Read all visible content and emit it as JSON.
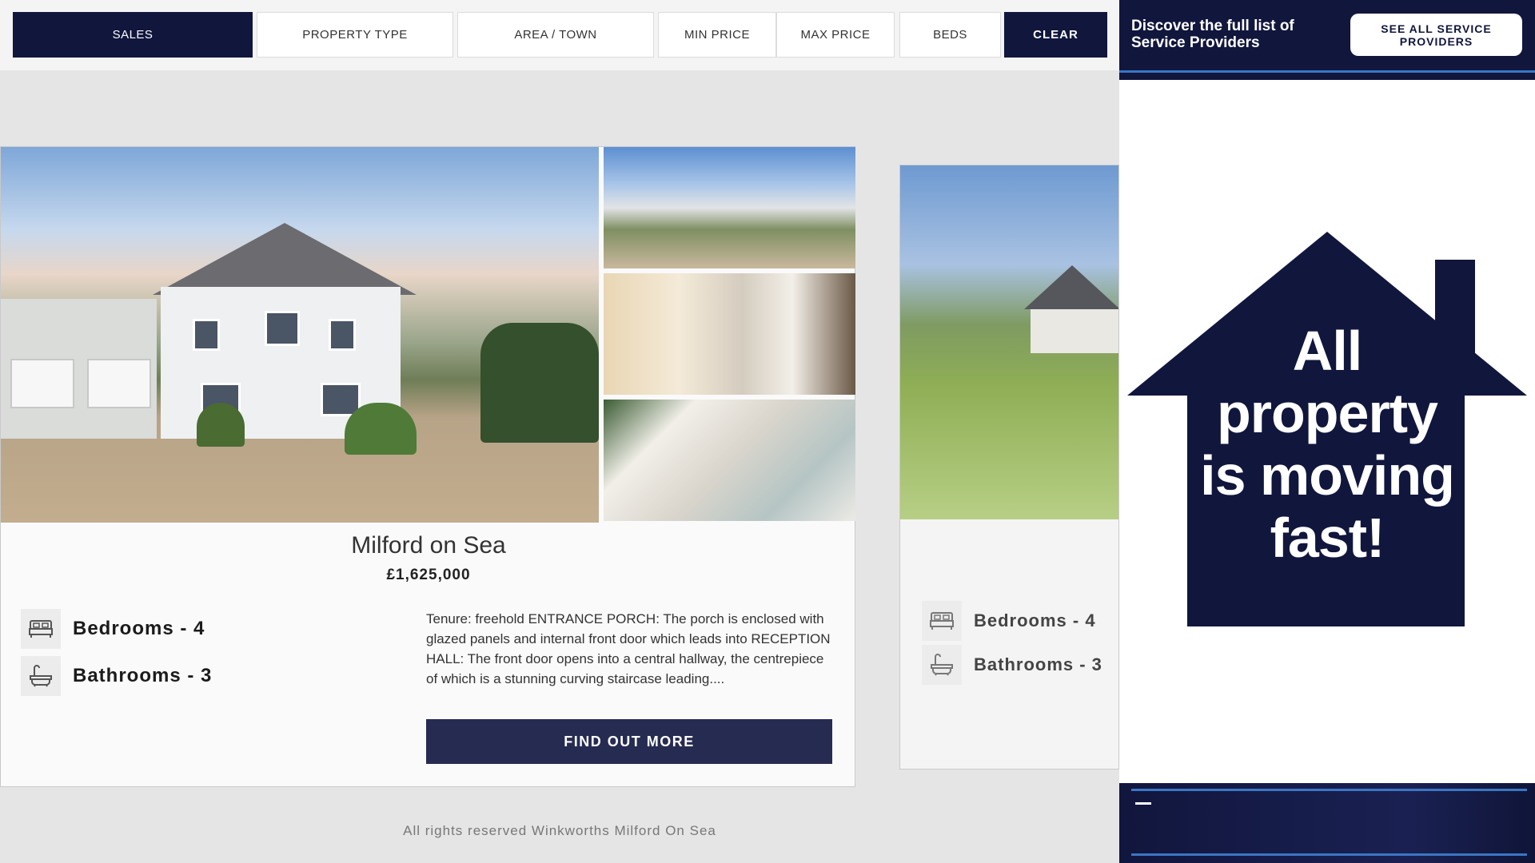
{
  "filters": {
    "sales": "SALES",
    "property_type": "PROPERTY TYPE",
    "area_town": "AREA / TOWN",
    "min_price": "MIN PRICE",
    "max_price": "MAX PRICE",
    "beds": "BEDS",
    "clear": "CLEAR"
  },
  "listing": {
    "title": "Milford on Sea",
    "price": "£1,625,000",
    "bedrooms": "Bedrooms - 4",
    "bathrooms": "Bathrooms - 3",
    "description": "Tenure: freehold ENTRANCE PORCH: The porch is enclosed with glazed panels and internal front door which leads into RECEPTION HALL: The front door opens into a central hallway, the centrepiece of which is a stunning curving staircase leading....",
    "cta": "FIND OUT MORE"
  },
  "listing2": {
    "bedrooms": "Bedrooms - 4",
    "bathrooms": "Bathrooms - 3"
  },
  "footer": "All rights reserved Winkworths Milford On Sea",
  "sidebar": {
    "service_text": "Discover the full list of Service Providers",
    "service_button": "SEE ALL SERVICE PROVIDERS",
    "ad_line1": "All",
    "ad_line2": "property",
    "ad_line3": "is moving",
    "ad_line4": "fast!"
  },
  "colors": {
    "navy": "#11163d",
    "button": "#262b51",
    "accent_line": "#3b76c4"
  },
  "icons": {
    "bed": "bed-icon",
    "bath": "bath-icon"
  }
}
